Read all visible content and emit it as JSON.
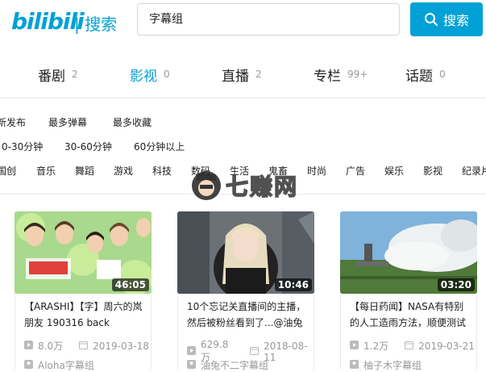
{
  "header": {
    "logo": "bilibili",
    "section": "| 搜索",
    "search_value": "字幕组",
    "search_button": "搜索"
  },
  "tabs": [
    {
      "label": "番剧",
      "count": "2",
      "active": false
    },
    {
      "label": "影视",
      "count": "0",
      "active": true
    },
    {
      "label": "直播",
      "count": "2",
      "active": false
    },
    {
      "label": "专栏",
      "count": "99+",
      "active": false
    },
    {
      "label": "话题",
      "count": "0",
      "active": false
    }
  ],
  "filters": {
    "sort": [
      "新发布",
      "最多弹幕",
      "最多收藏"
    ],
    "duration": [
      "0-30分钟",
      "30-60分钟",
      "60分钟以上"
    ],
    "zones": [
      "国创",
      "音乐",
      "舞蹈",
      "游戏",
      "科技",
      "数码",
      "生活",
      "鬼畜",
      "时尚",
      "广告",
      "娱乐",
      "影视",
      "纪录片"
    ]
  },
  "watermark": "七赚网",
  "cards": [
    {
      "duration": "46:05",
      "title": "【ARASHI】【字】周六的岚朋友 190316 back",
      "views": "8.0万",
      "date": "2019-03-18",
      "uploader": "Aloha字幕组"
    },
    {
      "duration": "10:46",
      "title": "10个忘记关直播间的主播，然后被粉丝看到了...@油兔",
      "views": "629.8万",
      "date": "2018-08-11",
      "uploader": "油兔不二字幕组"
    },
    {
      "duration": "03:20",
      "title": "【每日药闻】NASA有特别的人工造雨方法，顺便测试",
      "views": "1.2万",
      "date": "2019-03-21",
      "uploader": "柚子木字幕组"
    }
  ]
}
